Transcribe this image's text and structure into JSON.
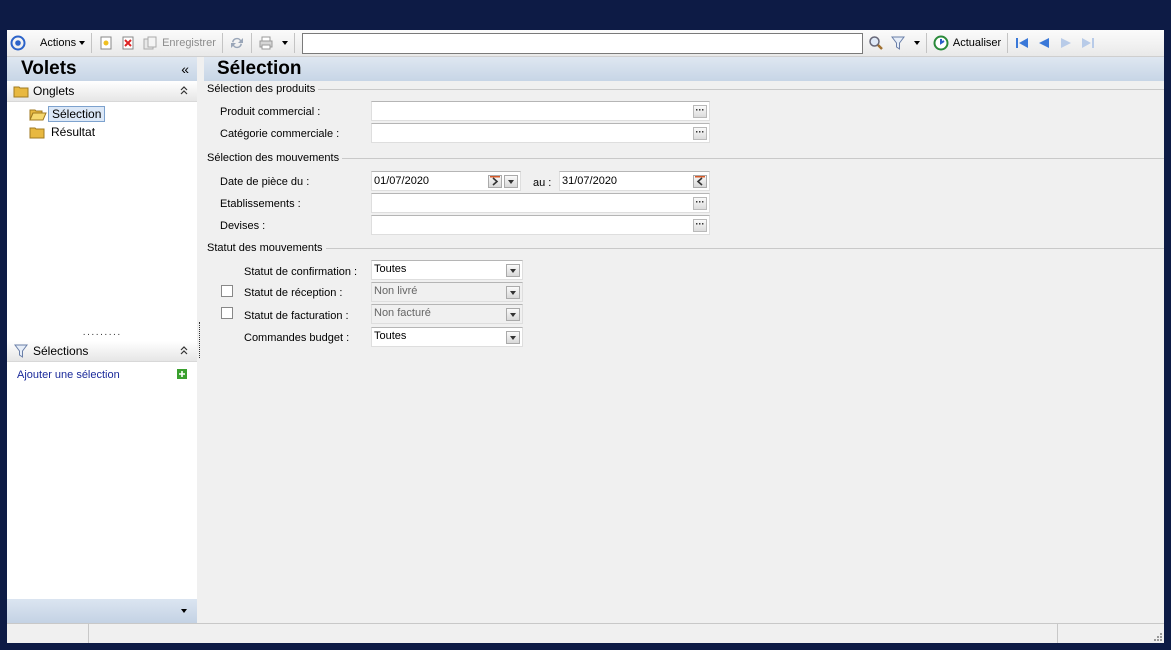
{
  "toolbar": {
    "actions_label": "Actions",
    "save_label": "Enregistrer",
    "search_value": "",
    "refresh_label": "Actualiser"
  },
  "left_pane": {
    "title": "Volets",
    "collapse_glyph": "«",
    "tabs_section": {
      "title": "Onglets",
      "items": [
        {
          "label": "Sélection",
          "selected": true
        },
        {
          "label": "Résultat",
          "selected": false
        }
      ]
    },
    "selections_section": {
      "title": "Sélections",
      "add_link": "Ajouter une sélection"
    }
  },
  "main": {
    "title": "Sélection",
    "groups": {
      "products": "Sélection des produits",
      "movements": "Sélection des mouvements",
      "status": "Statut des mouvements"
    },
    "fields": {
      "produit_commercial": {
        "label": "Produit commercial :",
        "value": ""
      },
      "categorie_commerciale": {
        "label": "Catégorie commerciale :",
        "value": ""
      },
      "date_piece": {
        "label": "Date de pièce du :",
        "from": "01/07/2020",
        "to_label": "au :",
        "to": "31/07/2020"
      },
      "etablissements": {
        "label": "Etablissements :",
        "value": ""
      },
      "devises": {
        "label": "Devises :",
        "value": ""
      },
      "statut_confirmation": {
        "label": "Statut de confirmation :",
        "value": "Toutes"
      },
      "statut_reception": {
        "label": "Statut de réception :",
        "value": "Non livré",
        "checked": false
      },
      "statut_facturation": {
        "label": "Statut de facturation :",
        "value": "Non facturé",
        "checked": false
      },
      "commandes_budget": {
        "label": "Commandes budget :",
        "value": "Toutes"
      }
    }
  },
  "colors": {
    "background": "#0d1b45",
    "header_gradient_top": "#dfe7f1",
    "header_gradient_bottom": "#c7d5e6",
    "link": "#1a2a9a",
    "add_icon": "#3aa02e"
  }
}
